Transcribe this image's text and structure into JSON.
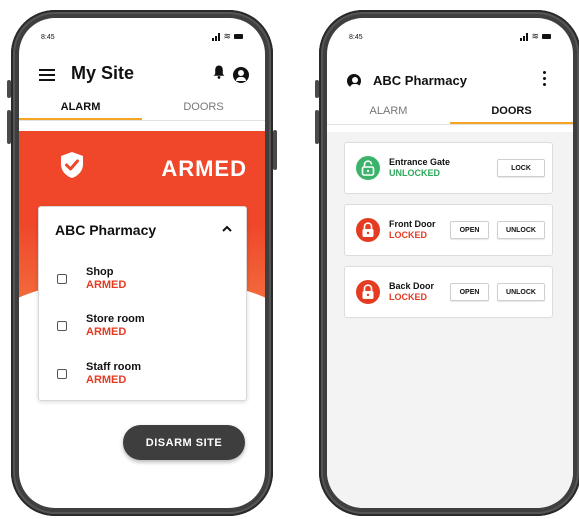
{
  "colors": {
    "alarm_red": "#f0472a",
    "armed_text": "#e53b22",
    "unlocked_green": "#3bb36a",
    "tab_underline": "#f5a524",
    "dark_button": "#3e3e3e"
  },
  "left_phone": {
    "status": {
      "time": "8:45"
    },
    "header": {
      "title": "My Site",
      "menu_icon": "hamburger-menu-icon",
      "bell_icon": "bell-icon",
      "account_icon": "account-circle-icon"
    },
    "tabs": [
      {
        "label": "ALARM",
        "active": true
      },
      {
        "label": "DOORS",
        "active": false
      }
    ],
    "banner": {
      "status": "ARMED",
      "icon": "shield-check-icon"
    },
    "site_card": {
      "title": "ABC Pharmacy",
      "zones": [
        {
          "name": "Shop",
          "state": "ARMED"
        },
        {
          "name": "Store room",
          "state": "ARMED"
        },
        {
          "name": "Staff room",
          "state": "ARMED"
        }
      ]
    },
    "disarm_button": "DISARM SITE"
  },
  "right_phone": {
    "status": {
      "time": "8:45"
    },
    "header": {
      "title": "ABC Pharmacy",
      "account_icon": "account-circle-icon",
      "menu_icon": "more-vertical-icon"
    },
    "tabs": [
      {
        "label": "ALARM",
        "active": false
      },
      {
        "label": "DOORS",
        "active": true
      }
    ],
    "doors": [
      {
        "name": "Entrance Gate",
        "state": "UNLOCKED",
        "icon": "unlocked-padlock-icon",
        "buttons": [
          "LOCK"
        ]
      },
      {
        "name": "Front Door",
        "state": "LOCKED",
        "icon": "locked-padlock-icon",
        "buttons": [
          "OPEN",
          "UNLOCK"
        ]
      },
      {
        "name": "Back Door",
        "state": "LOCKED",
        "icon": "locked-padlock-icon",
        "buttons": [
          "OPEN",
          "UNLOCK"
        ]
      }
    ]
  }
}
